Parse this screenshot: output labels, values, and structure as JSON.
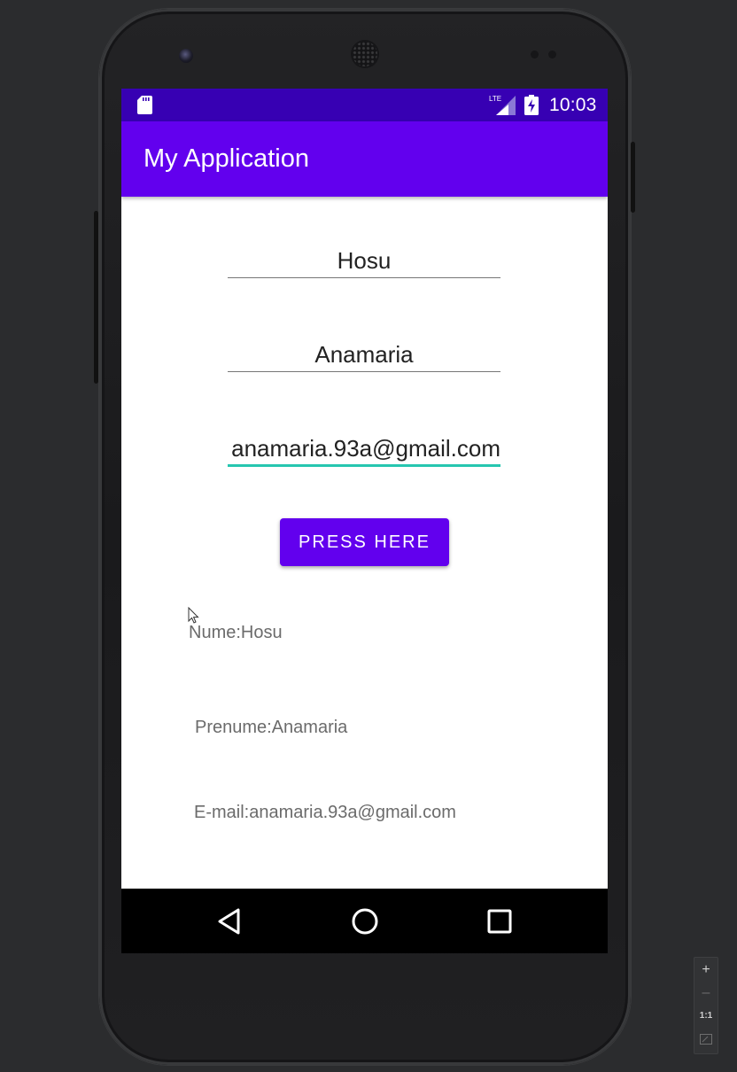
{
  "status_bar": {
    "time": "10:03",
    "network_label": "LTE",
    "icons": [
      "sd-card-icon",
      "lte-signal-icon",
      "battery-charging-icon"
    ]
  },
  "app_bar": {
    "title": "My Application"
  },
  "form": {
    "nume_value": "Hosu",
    "prenume_value": "Anamaria",
    "email_value": "anamaria.93a@gmail.com"
  },
  "button": {
    "label": "PRESS HERE"
  },
  "output": {
    "nume": "Nume:Hosu",
    "prenume": "Prenume:Anamaria",
    "email": "E-mail:anamaria.93a@gmail.com"
  },
  "nav_bar": {
    "icons": [
      "back-icon",
      "home-icon",
      "recents-icon"
    ]
  },
  "zoom_toolbar": {
    "zoom_in": "+",
    "zoom_out": "–",
    "actual_size": "1:1"
  },
  "colors": {
    "status_bar": "#3700b3",
    "app_bar": "#6200ee",
    "button": "#6200ee",
    "focus_underline": "#26c6b0"
  }
}
